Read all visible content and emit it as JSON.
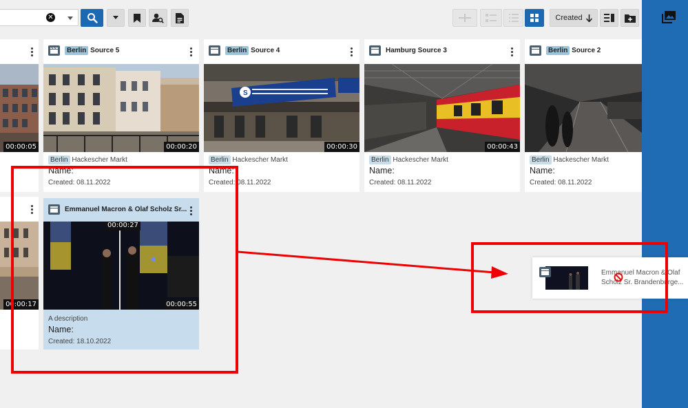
{
  "toolbar": {
    "search_value": "",
    "sort_label": "Created"
  },
  "cards": [
    {
      "title_tag": "",
      "title": "",
      "duration": "00:00:05",
      "location_tag": "",
      "location": "",
      "name_label": "",
      "created": ""
    },
    {
      "title_tag": "Berlin",
      "title": "Source 5",
      "duration": "00:00:20",
      "location_tag": "Berlin",
      "location": "Hackescher Markt",
      "name_label": "Name:",
      "created": "Created: 08.11.2022"
    },
    {
      "title_tag": "Berlin",
      "title": "Source 4",
      "duration": "00:00:30",
      "location_tag": "Berlin",
      "location": "Hackescher Markt",
      "name_label": "Name:",
      "created": "Created: 08.11.2022"
    },
    {
      "title_tag": "",
      "title": "Hamburg Source 3",
      "duration": "00:00:43",
      "location_tag": "Berlin",
      "location": "Hackescher Markt",
      "name_label": "Name:",
      "created": "Created: 08.11.2022"
    },
    {
      "title_tag": "Berlin",
      "title": "Source 2",
      "duration": "",
      "location_tag": "Berlin",
      "location": "Hackescher Markt",
      "name_label": "Name:",
      "created": "Created: 08.11.2022"
    },
    {
      "title_tag": "",
      "title": "",
      "duration": "00:00:17",
      "location_tag": "",
      "location": "",
      "name_label": "",
      "created": ""
    },
    {
      "title_tag": "",
      "title": "Emmanuel Macron & Olaf Scholz Sr...",
      "duration": "00:00:55",
      "marker_time": "00:00:27",
      "description": "A description",
      "name_label": "Name:",
      "created": "Created: 18.10.2022"
    }
  ],
  "drag_preview": {
    "line1": "Emmanuel Macron & Olaf",
    "line2": "Scholz Sr. Brandenburge..."
  },
  "colors": {
    "accent": "#1c68b3",
    "sidebar": "#1f6cb5",
    "selected_card": "#c7dcec",
    "tag": "#9cc5dc",
    "annotation": "#ee0000"
  }
}
